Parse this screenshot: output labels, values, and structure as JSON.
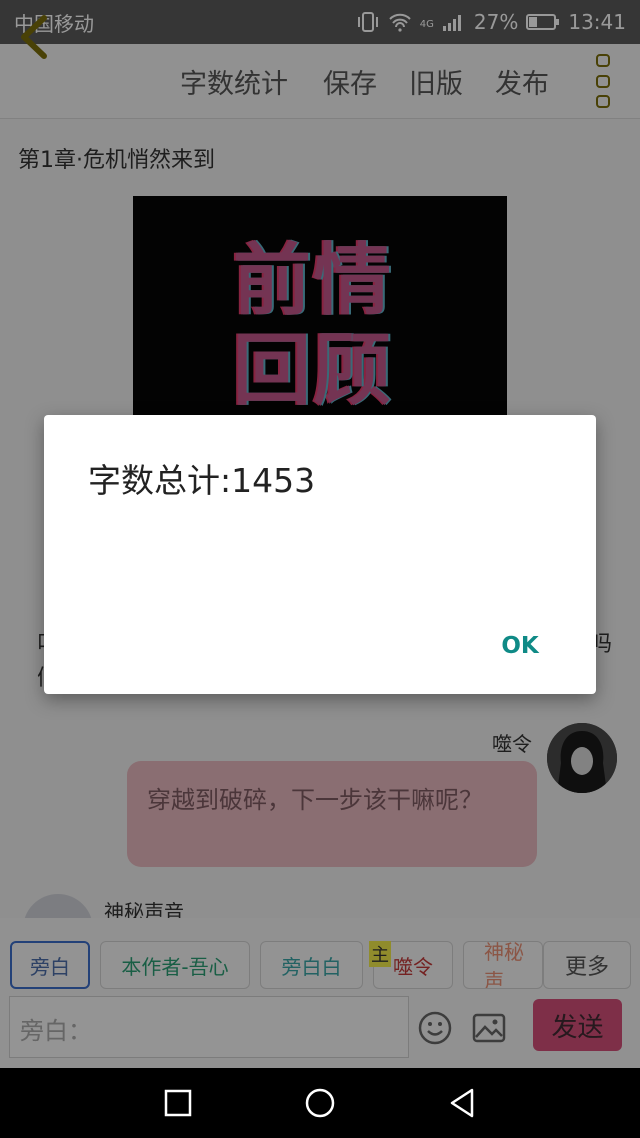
{
  "status_bar": {
    "carrier": "中国移动",
    "network": "4G",
    "battery": "27%",
    "time": "13:41"
  },
  "toolbar": {
    "word_count": "字数统计",
    "save": "保存",
    "old_version": "旧版",
    "publish": "发布"
  },
  "chapter_title": "第1章·危机悄然来到",
  "image": {
    "text_line1": "前情",
    "text_line2": "回顾"
  },
  "hidden_fragments": {
    "left1": "叫",
    "left2": "们",
    "right1": "吗"
  },
  "chat": {
    "right_speaker": "噬令",
    "right_message": "穿越到破碎，下一步该干嘛呢？",
    "left_speaker": "神秘声音"
  },
  "roles": {
    "chips": [
      "旁白",
      "本作者-吾心",
      "旁白白",
      "噬令",
      "神秘声"
    ],
    "main_tag": "主",
    "more": "更多"
  },
  "composer": {
    "placeholder": "旁白：",
    "send": "发送"
  },
  "dialog": {
    "message": "字数总计:1453",
    "ok": "OK"
  },
  "colors": {
    "accent_ok": "#0f8a86",
    "send_button": "#d24f78",
    "bubble": "#e7b8be"
  }
}
